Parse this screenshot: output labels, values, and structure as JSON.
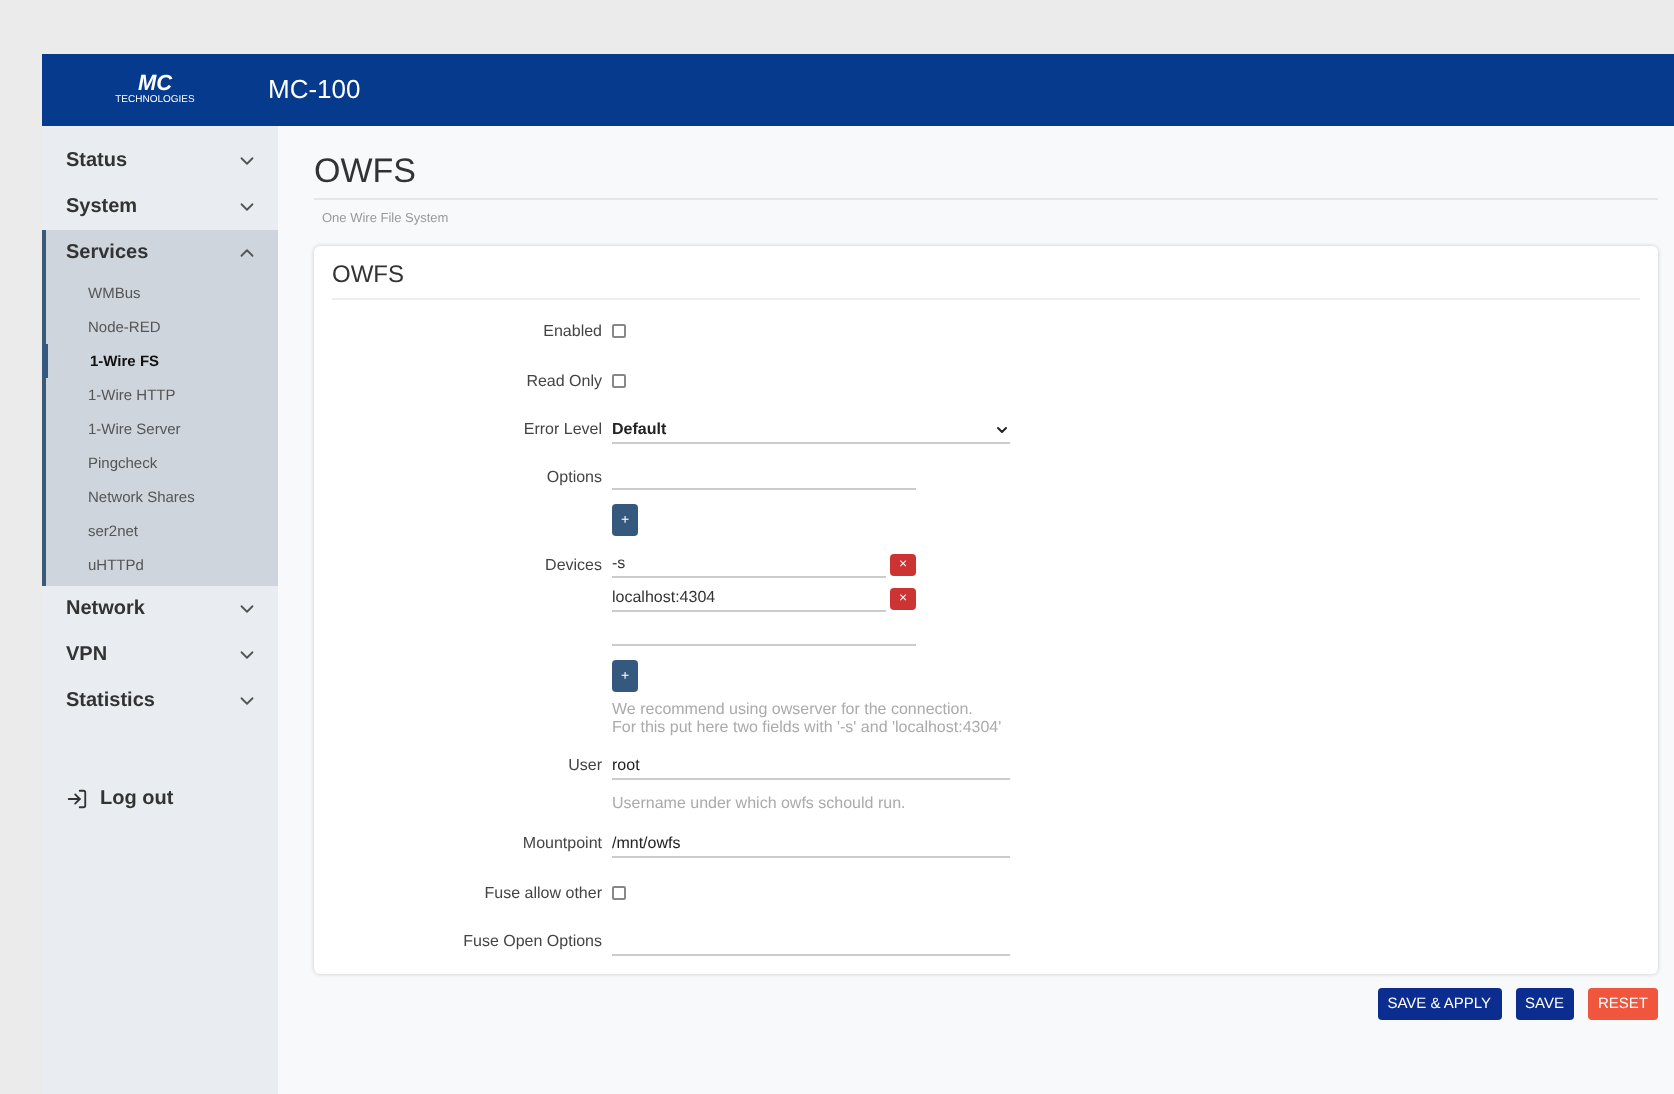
{
  "header": {
    "logo": {
      "text": "MC",
      "subtext": "TECHNOLOGIES"
    },
    "title": "MC-100"
  },
  "sidebar": {
    "items": [
      {
        "label": "Status",
        "expanded": false
      },
      {
        "label": "System",
        "expanded": false
      },
      {
        "label": "Services",
        "expanded": true,
        "children": [
          {
            "label": "WMBus",
            "selected": false
          },
          {
            "label": "Node-RED",
            "selected": false
          },
          {
            "label": "1-Wire FS",
            "selected": true
          },
          {
            "label": "1-Wire HTTP",
            "selected": false
          },
          {
            "label": "1-Wire Server",
            "selected": false
          },
          {
            "label": "Pingcheck",
            "selected": false
          },
          {
            "label": "Network Shares",
            "selected": false
          },
          {
            "label": "ser2net",
            "selected": false
          },
          {
            "label": "uHTTPd",
            "selected": false
          }
        ]
      },
      {
        "label": "Network",
        "expanded": false
      },
      {
        "label": "VPN",
        "expanded": false
      },
      {
        "label": "Statistics",
        "expanded": false
      }
    ],
    "logout": "Log out"
  },
  "page": {
    "title": "OWFS",
    "description": "One Wire File System"
  },
  "section": {
    "title": "OWFS",
    "fields": [
      {
        "kind": "checkbox",
        "label": "Enabled",
        "checked": false
      },
      {
        "kind": "checkbox",
        "label": "Read Only",
        "checked": false
      },
      {
        "kind": "select",
        "label": "Error Level",
        "value": "Default"
      },
      {
        "kind": "list",
        "label": "Options",
        "add": "+"
      },
      {
        "kind": "list",
        "label": "Devices",
        "values": [
          "-s",
          "localhost:4304"
        ],
        "remove": "×",
        "add": "+",
        "hint": [
          "We recommend using owserver for the connection.",
          "For this put here two fields with '-s' and 'localhost:4304'"
        ]
      },
      {
        "kind": "text",
        "label": "User",
        "value": "root",
        "hint": [
          "Username under which owfs schould run."
        ]
      },
      {
        "kind": "text",
        "label": "Mountpoint",
        "value": "/mnt/owfs"
      },
      {
        "kind": "checkbox",
        "label": "Fuse allow other",
        "checked": false
      },
      {
        "kind": "text",
        "label": "Fuse Open Options"
      }
    ]
  },
  "actions": [
    {
      "label": "SAVE & APPLY",
      "kind": "primary"
    },
    {
      "label": "SAVE",
      "kind": "primary"
    },
    {
      "label": "RESET",
      "kind": "danger"
    }
  ]
}
